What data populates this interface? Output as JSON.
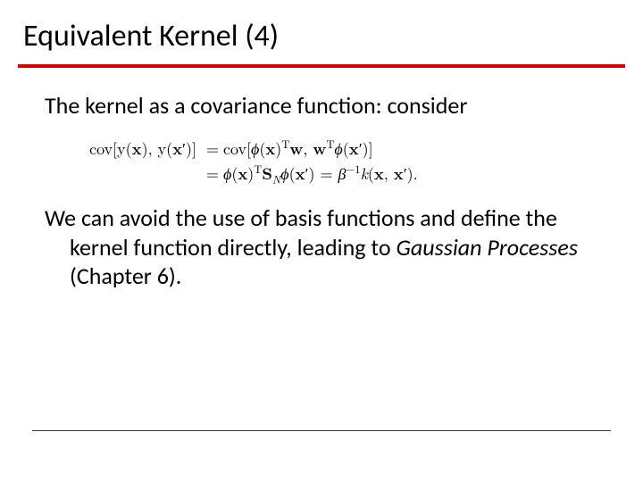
{
  "title": "Equivalent Kernel (4)",
  "para1": "The kernel as a covariance function: consider",
  "equation": {
    "lhs": "cov[y(𝐱), y(𝐱′)]",
    "line1_rhs": "cov[ϕ(𝐱)ᵀ𝐰, 𝐰ᵀϕ(𝐱′)]",
    "line2_rhs": "ϕ(𝐱)ᵀ𝐒_N ϕ(𝐱′) = β⁻¹k(𝐱, 𝐱′)."
  },
  "para2_a": "We can avoid the use of basis functions and define the kernel function directly, leading to  ",
  "para2_italic": "Gaussian Processes",
  "para2_b": " (Chapter 6)."
}
